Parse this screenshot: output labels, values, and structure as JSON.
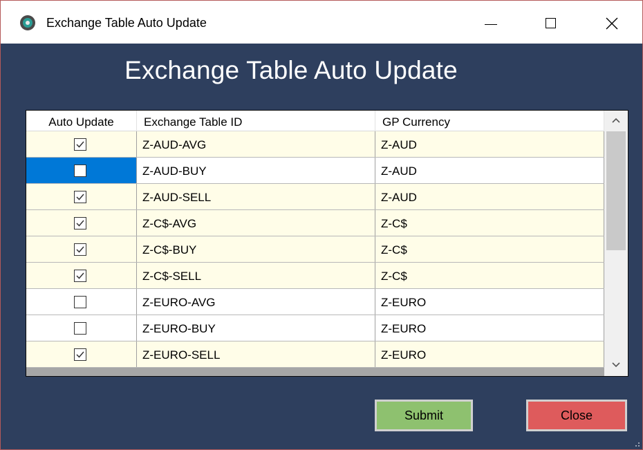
{
  "window": {
    "title": "Exchange Table Auto Update",
    "icon": "app-icon",
    "controls": {
      "minimize": "minimize-icon",
      "maximize": "maximize-icon",
      "close": "close-icon"
    }
  },
  "form": {
    "heading": "Exchange Table Auto Update"
  },
  "grid": {
    "columns": [
      "Auto Update",
      "Exchange Table ID",
      "GP Currency"
    ],
    "rows": [
      {
        "auto_update": true,
        "table_id": "Z-AUD-AVG",
        "currency": "Z-AUD",
        "background": "#fffde8",
        "selected": false
      },
      {
        "auto_update": false,
        "table_id": "Z-AUD-BUY",
        "currency": "Z-AUD",
        "background": "#ffffff",
        "selected": true
      },
      {
        "auto_update": true,
        "table_id": "Z-AUD-SELL",
        "currency": "Z-AUD",
        "background": "#fffde8",
        "selected": false
      },
      {
        "auto_update": true,
        "table_id": "Z-C$-AVG",
        "currency": "Z-C$",
        "background": "#fffde8",
        "selected": false
      },
      {
        "auto_update": true,
        "table_id": "Z-C$-BUY",
        "currency": "Z-C$",
        "background": "#fffde8",
        "selected": false
      },
      {
        "auto_update": true,
        "table_id": "Z-C$-SELL",
        "currency": "Z-C$",
        "background": "#fffde8",
        "selected": false
      },
      {
        "auto_update": false,
        "table_id": "Z-EURO-AVG",
        "currency": "Z-EURO",
        "background": "#ffffff",
        "selected": false
      },
      {
        "auto_update": false,
        "table_id": "Z-EURO-BUY",
        "currency": "Z-EURO",
        "background": "#ffffff",
        "selected": false
      },
      {
        "auto_update": true,
        "table_id": "Z-EURO-SELL",
        "currency": "Z-EURO",
        "background": "#fffde8",
        "selected": false
      }
    ]
  },
  "buttons": {
    "submit": "Submit",
    "close": "Close"
  },
  "colors": {
    "form_background": "#2e3f5e",
    "selection": "#0078d7",
    "submit": "#8ec16f",
    "close": "#de5b5c"
  }
}
